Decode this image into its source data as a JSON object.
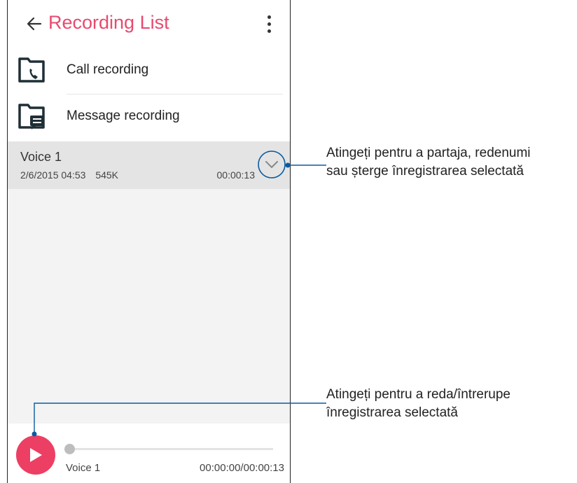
{
  "header": {
    "title": "Recording List"
  },
  "categories": [
    {
      "label": "Call recording"
    },
    {
      "label": "Message recording"
    }
  ],
  "recording": {
    "name": "Voice 1",
    "date": "2/6/2015 04:53",
    "size": "545K",
    "duration": "00:00:13"
  },
  "player": {
    "name": "Voice 1",
    "time": "00:00:00/00:00:13",
    "progress": 0.0
  },
  "callouts": [
    {
      "line1": "Atingeți pentru a partaja, redenumi",
      "line2": "sau șterge înregistrarea selectată"
    },
    {
      "line1": "Atingeți pentru a reda/întrerupe",
      "line2": "înregistrarea selectată"
    }
  ],
  "colors": {
    "accent": "#e84a6f",
    "play": "#ec3f63",
    "callout_line": "#0b5aa0",
    "icon_dark": "#1f2f36"
  }
}
